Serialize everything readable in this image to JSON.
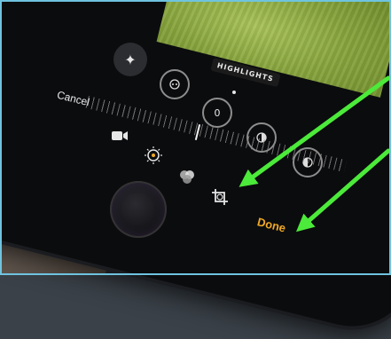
{
  "editor": {
    "photo_label": "HIGHLIGHTS",
    "cancel_label": "Cancel",
    "done_label": "Done",
    "exposure_value": "0"
  },
  "icons": {
    "auto_enhance": "magic-wand-icon",
    "exposure": "exposure-icon",
    "highlights": "highlights-icon",
    "shadows": "shadows-icon",
    "video": "video-icon",
    "adjust": "adjust-dial-icon",
    "filters": "filters-icon",
    "crop": "crop-rotate-icon"
  },
  "colors": {
    "done_accent": "#f0a826",
    "annotation_arrow": "#4cea3a"
  }
}
